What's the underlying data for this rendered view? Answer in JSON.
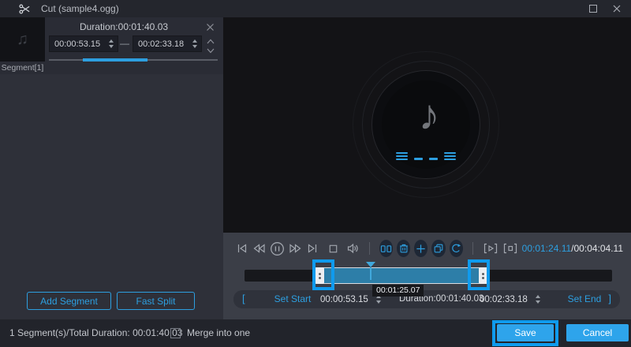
{
  "colors": {
    "accent": "#2d9fe0",
    "highlight_annotation": "#0f9bee",
    "timeline_selection": "#2d7ea8",
    "button_fill": "#2ea4eb"
  },
  "titlebar": {
    "title": "Cut (sample4.ogg)"
  },
  "segment_panel": {
    "segment_label": "Segment[1]",
    "duration_label": "Duration:00:01:40.03",
    "start_time": "00:00:53.15",
    "end_time": "00:02:33.18",
    "range_separator": "—",
    "add_segment_button": "Add Segment",
    "fast_split_button": "Fast Split"
  },
  "player": {
    "current_time": "00:01:24.11",
    "total_time": "/00:04:04.11"
  },
  "timeline": {
    "playhead_time": "00:01:25.07",
    "bracket_open": "[",
    "set_start_button": "Set Start",
    "start_time": "00:00:53.15",
    "duration_label": "Duration:00:01:40.03",
    "end_time": "00:02:33.18",
    "set_end_button": "Set End",
    "bracket_close": "]"
  },
  "footer": {
    "summary": "1 Segment(s)/Total Duration: 00:01:40.03",
    "merge_checkbox_label": "Merge into one",
    "save_button": "Save",
    "cancel_button": "Cancel"
  }
}
